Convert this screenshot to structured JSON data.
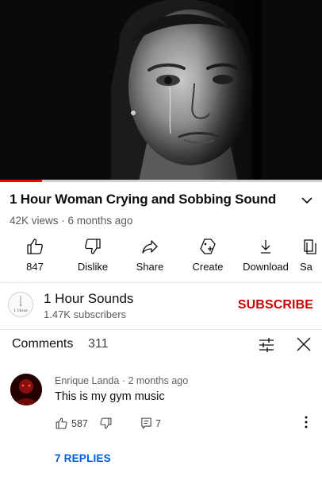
{
  "player": {
    "progress_fraction": 0.13,
    "progress_color": "#ff0000"
  },
  "video": {
    "title": "1 Hour Woman Crying and Sobbing Sound",
    "views": "42K views",
    "age": "6 months ago",
    "meta_separator": " · "
  },
  "actions": [
    {
      "icon": "thumbs-up-icon",
      "label": "847"
    },
    {
      "icon": "thumbs-down-icon",
      "label": "Dislike"
    },
    {
      "icon": "share-icon",
      "label": "Share"
    },
    {
      "icon": "create-icon",
      "label": "Create"
    },
    {
      "icon": "download-icon",
      "label": "Download"
    },
    {
      "icon": "save-icon",
      "label": "Sa"
    }
  ],
  "channel": {
    "name": "1 Hour Sounds",
    "subscribers": "1.47K subscribers",
    "avatar_text": "1 Hour",
    "subscribe_label": "SUBSCRIBE",
    "subscribe_color": "#cc0000"
  },
  "comments": {
    "title": "Comments",
    "count": "311",
    "items": [
      {
        "author": "Enrique Landa",
        "age": "2 months ago",
        "author_separator": " · ",
        "text": "This is my gym music",
        "likes": "587",
        "replies_count": "7",
        "replies_label": "7 REPLIES"
      }
    ]
  },
  "colors": {
    "link_blue": "#065fd4",
    "secondary_text": "#606060"
  }
}
